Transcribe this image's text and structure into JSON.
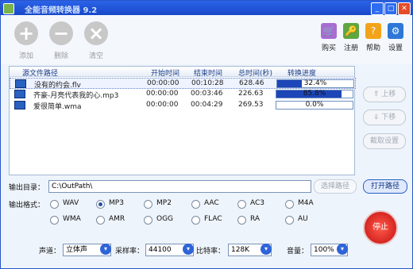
{
  "window": {
    "title": "全能音频转换器 9.2"
  },
  "toolbar": {
    "add": "添加",
    "remove": "删除",
    "clear": "清空",
    "buy": "购买",
    "register": "注册",
    "help": "帮助",
    "settings": "设置"
  },
  "list": {
    "headers": {
      "path": "源文件路径",
      "start": "开始时间",
      "end": "结束时间",
      "total": "总时间(秒)",
      "progress": "转换进度"
    },
    "rows": [
      {
        "name": "没有的约会.flv",
        "start": "00:00:00",
        "end": "00:10:28",
        "total": "628.46",
        "progress": "32.4%",
        "progress_value": 0.324
      },
      {
        "name": "齐豪-月亮代表我的心.mp3",
        "start": "00:00:00",
        "end": "00:03:46",
        "total": "226.63",
        "progress": "85.8%",
        "progress_value": 0.858
      },
      {
        "name": "爱很简单.wma",
        "start": "00:00:00",
        "end": "00:04:29",
        "total": "269.53",
        "progress": "0.0%",
        "progress_value": 0.0
      }
    ]
  },
  "side": {
    "up": "上移",
    "down": "下移",
    "crop": "截取设置"
  },
  "output": {
    "dir_label": "输出目录：",
    "path": "C:\\OutPath\\",
    "select_path": "选择路径",
    "open_path": "打开路径"
  },
  "format": {
    "label": "输出格式：",
    "options": [
      "WAV",
      "MP3",
      "MP2",
      "AAC",
      "AC3",
      "M4A",
      "WMA",
      "AMR",
      "OGG",
      "FLAC",
      "RA",
      "AU"
    ],
    "selected": "MP3"
  },
  "params": {
    "channel_label": "声道：",
    "channel": "立体声",
    "rate_label": "采样率：",
    "rate": "44100",
    "bitrate_label": "比特率：",
    "bitrate": "128K",
    "volume_label": "音量：",
    "volume": "100%"
  },
  "stop": "停止"
}
